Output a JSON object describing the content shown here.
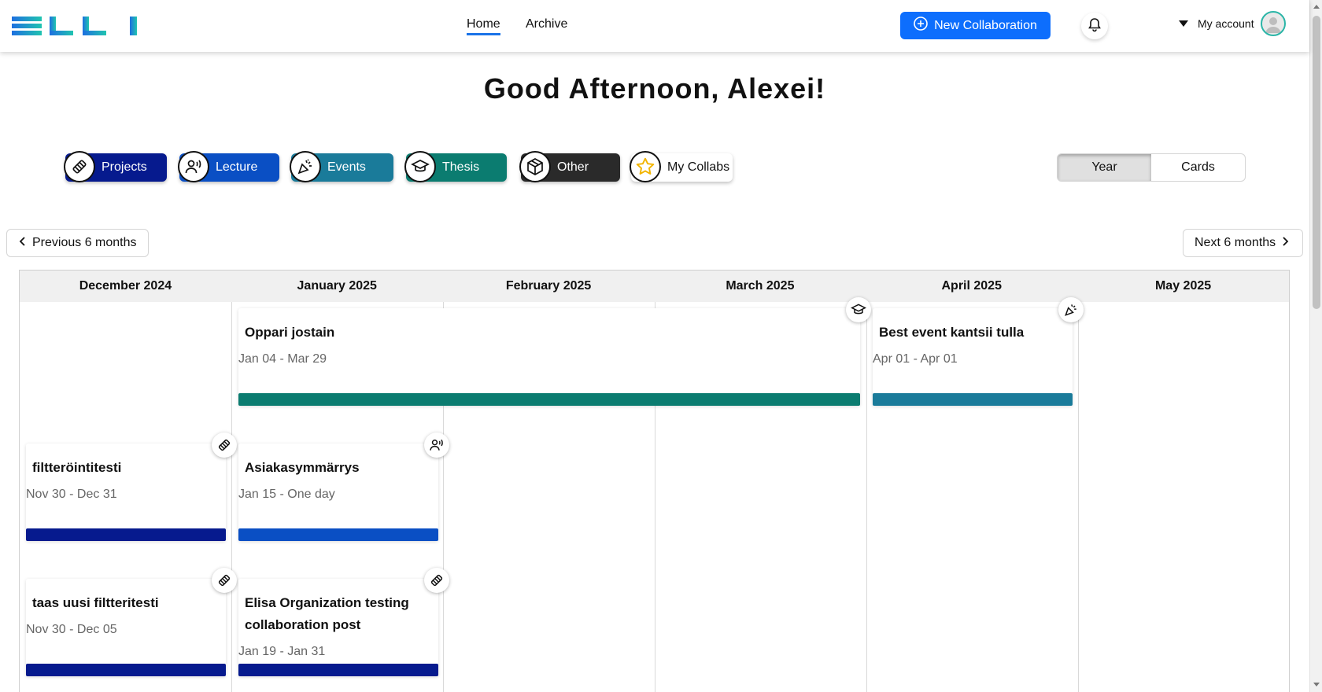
{
  "header": {
    "logo_text": "ELLI",
    "nav": [
      {
        "label": "Home",
        "active": true
      },
      {
        "label": "Archive",
        "active": false
      }
    ],
    "new_collab_label": "New Collaboration",
    "account_label": "My account"
  },
  "greeting": "Good Afternoon, Alexei!",
  "filters": [
    {
      "label": "Projects",
      "icon": "handshake-icon",
      "color": "#061a8e"
    },
    {
      "label": "Lecture",
      "icon": "speaker-icon",
      "color": "#0a4fc4"
    },
    {
      "label": "Events",
      "icon": "party-popper-icon",
      "color": "#1a7b9a"
    },
    {
      "label": "Thesis",
      "icon": "graduation-cap-icon",
      "color": "#0b7c70"
    },
    {
      "label": "Other",
      "icon": "box-icon",
      "color": "#2a2a2a"
    },
    {
      "label": "My Collabs",
      "icon": "star-icon",
      "color": "#ffffff"
    }
  ],
  "view_toggle": {
    "options": [
      "Year",
      "Cards"
    ],
    "selected": "Year"
  },
  "period_nav": {
    "prev_label": "Previous 6 months",
    "next_label": "Next 6 months"
  },
  "calendar": {
    "months": [
      "December 2024",
      "January 2025",
      "February 2025",
      "March 2025",
      "April 2025",
      "May 2025"
    ],
    "events": [
      {
        "title": "Oppari jostain",
        "dates": "Jan 04 - Mar 29",
        "type": "thesis",
        "color": "#0b7c70"
      },
      {
        "title": "Best event kantsii tulla",
        "dates": "Apr 01 - Apr 01",
        "type": "events",
        "color": "#1a7b9a"
      },
      {
        "title": "filtteröintitesti",
        "dates": "Nov 30 - Dec 31",
        "type": "projects",
        "color": "#061a8e"
      },
      {
        "title": "Asiakasymmärrys",
        "dates": "Jan 15 - One day",
        "type": "lecture",
        "color": "#0a4fc4"
      },
      {
        "title": "taas uusi filtteritesti",
        "dates": "Nov 30 - Dec 05",
        "type": "projects",
        "color": "#061a8e"
      },
      {
        "title": "Elisa Organization testing collaboration post",
        "dates": "Jan 19 - Jan 31",
        "type": "projects",
        "color": "#061a8e"
      }
    ]
  }
}
